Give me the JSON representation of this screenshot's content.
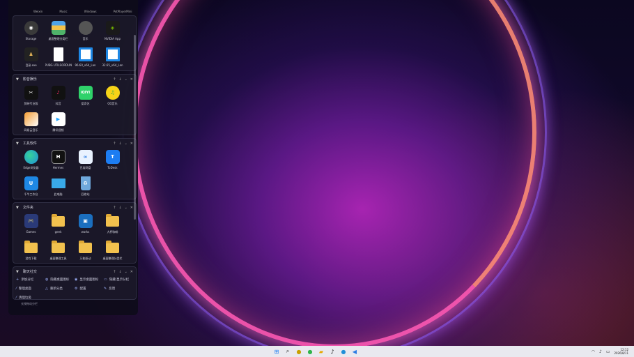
{
  "top_row_labels": [
    "Weixin",
    "Music",
    "Windows",
    "PotPlayerMini"
  ],
  "groups": [
    {
      "title": "",
      "apps": [
        {
          "label": "Storage",
          "icon": "storage-icon",
          "color": "#3a3a3a"
        },
        {
          "label": "桌面整理分类栏",
          "icon": "organizer-icon",
          "color": "#2b6cb0"
        },
        {
          "label": "音乐",
          "icon": "music-disc-icon",
          "color": "#555"
        },
        {
          "label": "NVIDIA App",
          "icon": "nvidia-icon",
          "color": "#1a1a1a"
        },
        {
          "label": "目录.exe",
          "icon": "exe-icon",
          "color": "#222"
        },
        {
          "label": "PUBG UTILSORDUNI",
          "icon": "file-icon",
          "color": "#ffffff"
        },
        {
          "label": "96.60_x64_Lan",
          "icon": "installer-icon",
          "color": "#1e88e5"
        },
        {
          "label": "32.65_x64_Lan",
          "icon": "installer-icon",
          "color": "#1e88e5"
        }
      ]
    },
    {
      "title": "影音娱乐",
      "apps": [
        {
          "label": "剪映专业版",
          "icon": "capcut-icon",
          "color": "#111"
        },
        {
          "label": "抖音",
          "icon": "douyin-icon",
          "color": "#111"
        },
        {
          "label": "爱奇艺",
          "icon": "iqiyi-icon",
          "color": "#2fd26a"
        },
        {
          "label": "QQ音乐",
          "icon": "qqmusic-icon",
          "color": "#f6d318"
        },
        {
          "label": "网易云音乐",
          "icon": "cloudmusic-icon",
          "color": "#f59d32"
        },
        {
          "label": "腾讯视频",
          "icon": "tencent-video-icon",
          "color": "#ffffff"
        }
      ]
    },
    {
      "title": "工具软件",
      "apps": [
        {
          "label": "Edge浏览器",
          "icon": "edge-icon",
          "color": "#1f8fd8"
        },
        {
          "label": "Hermes",
          "icon": "hermes-icon",
          "color": "#111"
        },
        {
          "label": "百度网盘",
          "icon": "baidu-netdisk-icon",
          "color": "#e9f2ff"
        },
        {
          "label": "ToDesk",
          "icon": "todesk-icon",
          "color": "#1d7df2"
        },
        {
          "label": "千牛工作台",
          "icon": "qianniu-icon",
          "color": "#1e88e5"
        },
        {
          "label": "此电脑",
          "icon": "computer-icon",
          "color": "#39a9e8"
        },
        {
          "label": "回收站",
          "icon": "recycle-bin-icon",
          "color": "#6fa8dc"
        }
      ]
    },
    {
      "title": "文件夹",
      "apps": [
        {
          "label": "Games",
          "icon": "games-icon",
          "color": "#2a3a78"
        },
        {
          "label": "geek",
          "icon": "folder-icon",
          "color": "#f2c14e"
        },
        {
          "label": "works",
          "icon": "works-icon",
          "color": "#1b6fbf"
        },
        {
          "label": "大杯咖啡",
          "icon": "folder-icon",
          "color": "#f2c14e"
        },
        {
          "label": "游戏下载",
          "icon": "folder-icon",
          "color": "#f2c14e"
        },
        {
          "label": "桌面整理工具",
          "icon": "folder-icon",
          "color": "#f2c14e"
        },
        {
          "label": "万能驱动",
          "icon": "folder-icon",
          "color": "#f2c14e"
        },
        {
          "label": "桌面整理分类栏",
          "icon": "folder-icon",
          "color": "#f2c14e"
        }
      ]
    }
  ],
  "social_group": {
    "title": "聊天社交",
    "actions": [
      "添加分栏",
      "隐藏桌面图标",
      "显示桌面图标",
      "隐藏/显示分栏",
      "整理桌面",
      "重新分类",
      "配置",
      "反馈",
      "清理垃圾"
    ]
  },
  "footer_note": "长按拖动分栏",
  "taskbar": {
    "apps": [
      "start-icon",
      "search-icon",
      "qq-icon",
      "wechat-icon",
      "explorer-icon",
      "tiktok-icon",
      "edge-icon",
      "vscode-icon"
    ],
    "time": "12:12",
    "date": "2026/8/11"
  }
}
